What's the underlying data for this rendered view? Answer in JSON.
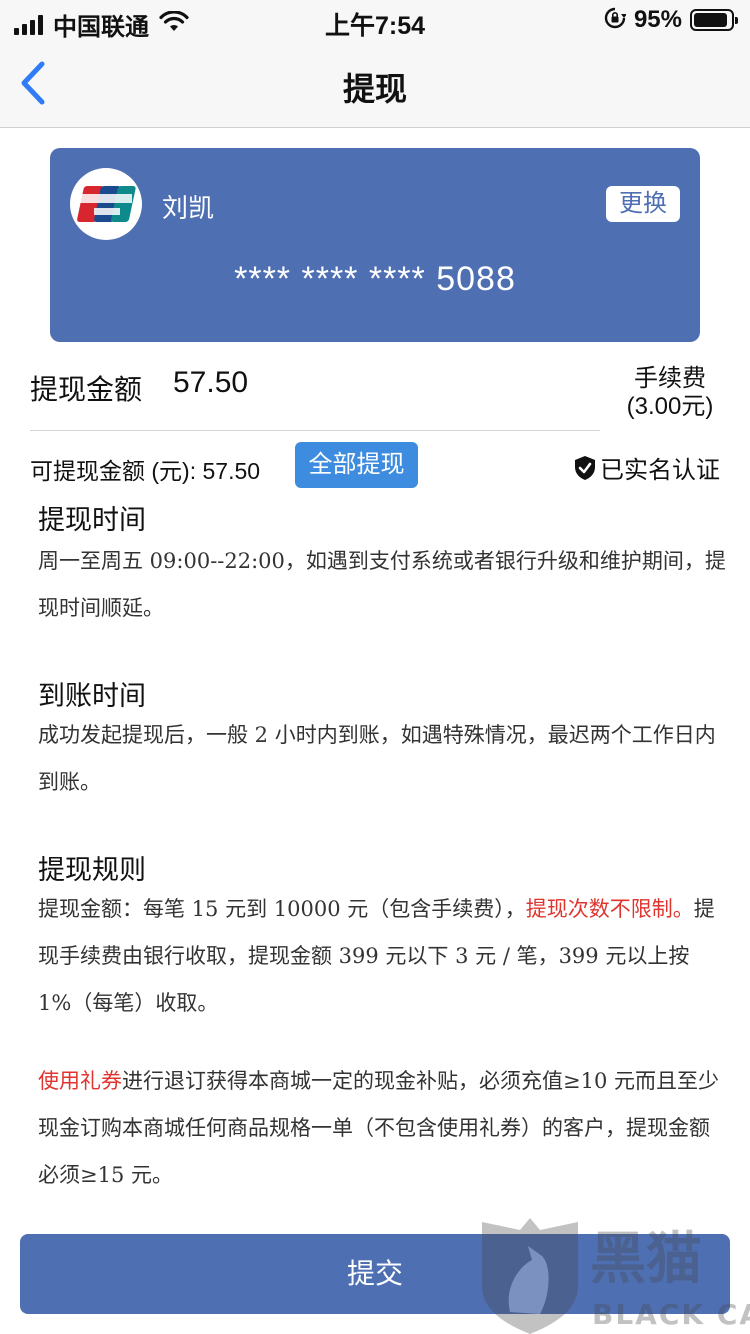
{
  "status_bar": {
    "carrier": "中国联通",
    "time": "上午7:54",
    "battery": "95%"
  },
  "nav": {
    "title": "提现"
  },
  "card": {
    "holder": "刘凯",
    "change_label": "更换",
    "number": "**** **** **** 5088"
  },
  "withdraw": {
    "amount_label": "提现金额",
    "amount_value": "57.50",
    "fee_label": "手续费",
    "fee_value": "(3.00元)",
    "available": "可提现金额 (元): 57.50",
    "withdraw_all_label": "全部提现",
    "verified_label": "已实名认证"
  },
  "sections": {
    "time": {
      "title": "提现时间",
      "text": "周一至周五 09:00--22:00，如遇到支付系统或者银行升级和维护期间，提现时间顺延。"
    },
    "arrival": {
      "title": "到账时间",
      "text": "成功发起提现后，一般 2 小时内到账，如遇特殊情况，最迟两个工作日内到账。"
    },
    "rules": {
      "title": "提现规则",
      "text_1": "提现金额：每笔 15 元到 10000 元（包含手续费），",
      "text_red": "提现次数不限制。",
      "text_2": "提现手续费由银行收取，提现金额 399 元以下 3 元 / 笔，399 元以上按 1%（每笔）收取。"
    },
    "coupon": {
      "text_red": "使用礼券",
      "text": "进行退订获得本商城一定的现金补贴，必须充值≥10 元而且至少现金订购本商城任何商品规格一单（不包含使用礼券）的客户，提现金额必须≥15 元。"
    }
  },
  "submit_label": "提交",
  "watermark": {
    "chinese": "黑猫",
    "english": "BLACK CAT"
  },
  "colors": {
    "card_blue": "#4f6fb3",
    "button_blue": "#3e8cdf",
    "highlight_red": "#e0352f",
    "back_blue": "#2f7cf6"
  }
}
